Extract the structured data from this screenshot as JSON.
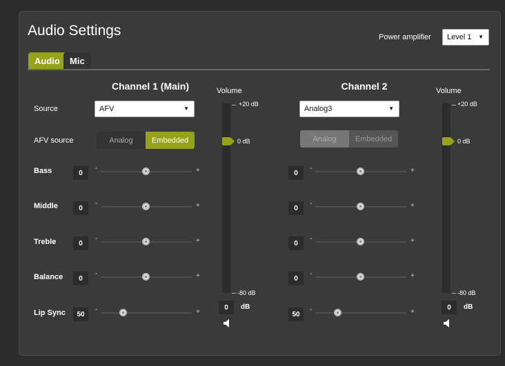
{
  "title": "Audio Settings",
  "power_amp": {
    "label": "Power amplifier",
    "value": "Level 1"
  },
  "tabs": [
    {
      "label": "Audio",
      "active": true
    },
    {
      "label": "Mic",
      "active": false
    }
  ],
  "labels": {
    "source": "Source",
    "afv_source": "AFV source",
    "bass": "Bass",
    "middle": "Middle",
    "treble": "Treble",
    "balance": "Balance",
    "lip_sync": "Lip Sync"
  },
  "channels": [
    {
      "title": "Channel 1 (Main)",
      "source": "AFV",
      "afv_toggle": {
        "options": [
          "Analog",
          "Embedded"
        ],
        "selected": "Embedded",
        "enabled": true
      },
      "bass": "0",
      "middle": "0",
      "treble": "0",
      "balance": "0",
      "lip_sync": "50",
      "volume": {
        "label": "Volume",
        "top": "+20 dB",
        "current": "0 dB",
        "bottom": "-80 dB",
        "input": "0",
        "unit": "dB"
      }
    },
    {
      "title": "Channel 2",
      "source": "Analog3",
      "afv_toggle": {
        "options": [
          "Analog",
          "Embedded"
        ],
        "selected": "Analog",
        "enabled": false
      },
      "bass": "0",
      "middle": "0",
      "treble": "0",
      "balance": "0",
      "lip_sync": "50",
      "volume": {
        "label": "Volume",
        "top": "+20 dB",
        "current": "0 dB",
        "bottom": "-80 dB",
        "input": "0",
        "unit": "dB"
      }
    }
  ],
  "slider_symbols": {
    "minus": "-",
    "plus": "+"
  },
  "slider_levels": {
    "bass": 0.5,
    "middle": 0.5,
    "treble": 0.5,
    "balance": 0.5,
    "lip_sync": 0.25
  },
  "volume_level": 0.8,
  "icons": {
    "dropdown": "caret-down-icon",
    "speaker": "speaker-icon"
  },
  "colors": {
    "accent": "#95a31a",
    "background": "#2b2b2b",
    "panel": "#3a3a3a"
  }
}
